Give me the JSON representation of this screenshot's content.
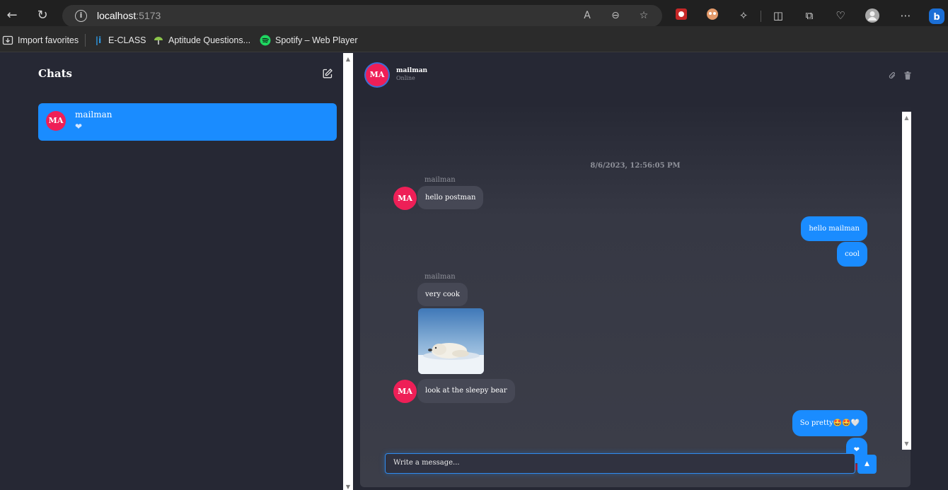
{
  "browser": {
    "url_host": "localhost",
    "url_port": ":5173",
    "bookmarks": [
      {
        "label": "Import favorites",
        "icon": "import-favorites-icon"
      },
      {
        "label": "E-CLASS",
        "icon": "eclass-icon"
      },
      {
        "label": "Aptitude Questions...",
        "icon": "aptitude-icon"
      },
      {
        "label": "Spotify – Web Player",
        "icon": "spotify-icon"
      }
    ],
    "colors": {
      "spotify": "#1ed760",
      "eclass": "#2f9be6"
    }
  },
  "sidebar": {
    "title": "Chats",
    "chats": [
      {
        "initials": "MA",
        "name": "mailman",
        "preview": "❤"
      }
    ]
  },
  "conversation": {
    "header": {
      "initials": "MA",
      "name": "mailman",
      "status": "Online"
    },
    "timestamp": "8/6/2023, 12:56:05 PM",
    "messages": [
      {
        "direction": "in",
        "sender": "mailman",
        "text": "hello postman"
      },
      {
        "direction": "out",
        "text": "hello mailman"
      },
      {
        "direction": "out",
        "text": "cool"
      },
      {
        "direction": "in",
        "sender": "mailman",
        "text": "very cook"
      },
      {
        "direction": "in",
        "type": "image",
        "image": "polar-bear-photo"
      },
      {
        "direction": "in",
        "text": "look at the sleepy bear"
      },
      {
        "direction": "out",
        "text": "So pretty🤩🤩🤍"
      },
      {
        "direction": "out",
        "text": "❤"
      }
    ],
    "avatar_initials": "MA",
    "composer": {
      "placeholder": "Write a message..."
    }
  },
  "colors": {
    "accent": "#1a8cff",
    "avatar": "#ee1f57",
    "incoming_bubble": "#464855",
    "background": "#262834",
    "read_dot_1": "#b0121f",
    "read_dot_2": "#ee1f57"
  }
}
